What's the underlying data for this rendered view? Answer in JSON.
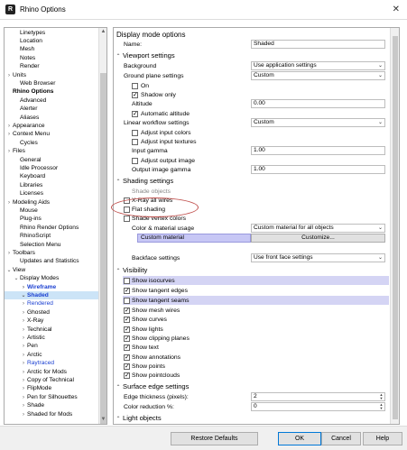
{
  "window": {
    "title": "Rhino Options",
    "close_glyph": "✕"
  },
  "tree": {
    "items": [
      {
        "label": "Linetypes",
        "indent": 1,
        "caret": ""
      },
      {
        "label": "Location",
        "indent": 1,
        "caret": ""
      },
      {
        "label": "Mesh",
        "indent": 1,
        "caret": ""
      },
      {
        "label": "Notes",
        "indent": 1,
        "caret": ""
      },
      {
        "label": "Render",
        "indent": 1,
        "caret": ""
      },
      {
        "label": "Units",
        "indent": 0,
        "caret": ">"
      },
      {
        "label": "Web Browser",
        "indent": 1,
        "caret": ""
      },
      {
        "label": "Rhino Options",
        "indent": 0,
        "caret": "",
        "bold": true
      },
      {
        "label": "Advanced",
        "indent": 1,
        "caret": ""
      },
      {
        "label": "Alerter",
        "indent": 1,
        "caret": ""
      },
      {
        "label": "Aliases",
        "indent": 1,
        "caret": ""
      },
      {
        "label": "Appearance",
        "indent": 0,
        "caret": ">"
      },
      {
        "label": "Context Menu",
        "indent": 0,
        "caret": ">"
      },
      {
        "label": "Cycles",
        "indent": 1,
        "caret": ""
      },
      {
        "label": "Files",
        "indent": 0,
        "caret": ">"
      },
      {
        "label": "General",
        "indent": 1,
        "caret": ""
      },
      {
        "label": "Idle Processor",
        "indent": 1,
        "caret": ""
      },
      {
        "label": "Keyboard",
        "indent": 1,
        "caret": ""
      },
      {
        "label": "Libraries",
        "indent": 1,
        "caret": ""
      },
      {
        "label": "Licenses",
        "indent": 1,
        "caret": ""
      },
      {
        "label": "Modeling Aids",
        "indent": 0,
        "caret": ">"
      },
      {
        "label": "Mouse",
        "indent": 1,
        "caret": ""
      },
      {
        "label": "Plug-ins",
        "indent": 1,
        "caret": ""
      },
      {
        "label": "Rhino Render Options",
        "indent": 1,
        "caret": ""
      },
      {
        "label": "RhinoScript",
        "indent": 1,
        "caret": ""
      },
      {
        "label": "Selection Menu",
        "indent": 1,
        "caret": ""
      },
      {
        "label": "Toolbars",
        "indent": 0,
        "caret": ">"
      },
      {
        "label": "Updates and Statistics",
        "indent": 1,
        "caret": ""
      },
      {
        "label": "View",
        "indent": 0,
        "caret": "v"
      },
      {
        "label": "Display Modes",
        "indent": 1,
        "caret": "v"
      },
      {
        "label": "Wireframe",
        "indent": 2,
        "caret": ">",
        "bold": true,
        "blue": true
      },
      {
        "label": "Shaded",
        "indent": 2,
        "caret": "v",
        "bold": true,
        "blue": true,
        "selected": true
      },
      {
        "label": "Rendered",
        "indent": 2,
        "caret": ">",
        "blue": true
      },
      {
        "label": "Ghosted",
        "indent": 2,
        "caret": ">"
      },
      {
        "label": "X-Ray",
        "indent": 2,
        "caret": ">"
      },
      {
        "label": "Technical",
        "indent": 2,
        "caret": ">"
      },
      {
        "label": "Artistic",
        "indent": 2,
        "caret": ">"
      },
      {
        "label": "Pen",
        "indent": 2,
        "caret": ">"
      },
      {
        "label": "Arctic",
        "indent": 2,
        "caret": ">"
      },
      {
        "label": "Raytraced",
        "indent": 2,
        "caret": ">",
        "blue": true
      },
      {
        "label": "Arctic for Mods",
        "indent": 2,
        "caret": ">"
      },
      {
        "label": "Copy of Technical",
        "indent": 2,
        "caret": ">"
      },
      {
        "label": "FlipMode",
        "indent": 2,
        "caret": ">"
      },
      {
        "label": "Pen for Silhouettes",
        "indent": 2,
        "caret": ">"
      },
      {
        "label": "Shade",
        "indent": 2,
        "caret": ">"
      },
      {
        "label": "Shaded for Mods",
        "indent": 2,
        "caret": ">"
      }
    ]
  },
  "panel": {
    "display_mode_options": "Display mode options",
    "name_label": "Name:",
    "name_value": "Shaded",
    "viewport_settings": "Viewport settings",
    "background_label": "Background",
    "background_value": "Use application settings",
    "ground_plane_label": "Ground plane settings",
    "ground_plane_value": "Custom",
    "on_label": "On",
    "shadow_only_label": "Shadow only",
    "altitude_label": "Altitude",
    "altitude_value": "0.00",
    "automatic_altitude_label": "Automatic altitude",
    "linear_workflow_label": "Linear workflow settings",
    "linear_workflow_value": "Custom",
    "adjust_input_colors": "Adjust input colors",
    "adjust_input_textures": "Adjust input textures",
    "input_gamma_label": "Input gamma",
    "input_gamma_value": "1.00",
    "adjust_output_image": "Adjust output image",
    "output_gamma_label": "Output image gamma",
    "output_gamma_value": "1.00",
    "shading_settings": "Shading settings",
    "shade_objects": "Shade objects",
    "xray_all_wires": "X-Ray all wires",
    "flat_shading": "Flat shading",
    "shade_vertex_colors": "Shade vertex colors",
    "color_material_label": "Color & material usage",
    "color_material_value": "Custom material for all objects",
    "custom_material": "Custom material",
    "customize_button": "Customize...",
    "backface_label": "Backface settings",
    "backface_value": "Use front face settings",
    "visibility": "Visibility",
    "show_isocurves": "Show isocurves",
    "show_tangent_edges": "Show tangent edges",
    "show_tangent_seams": "Show tangent seams",
    "show_mesh_wires": "Show mesh wires",
    "show_curves": "Show curves",
    "show_lights": "Show lights",
    "show_clipping_planes": "Show clipping planes",
    "show_text": "Show text",
    "show_annotations": "Show annotations",
    "show_points": "Show points",
    "show_pointclouds": "Show pointclouds",
    "surface_edge_settings": "Surface edge settings",
    "edge_thickness_label": "Edge thickness (pixels):",
    "edge_thickness_value": "2",
    "color_reduction_label": "Color reduction %:",
    "color_reduction_value": "0",
    "light_objects": "Light objects"
  },
  "buttons": {
    "restore_defaults": "Restore Defaults",
    "ok": "OK",
    "cancel": "Cancel",
    "help": "Help"
  },
  "colors": {
    "selection": "#cce4f7",
    "link_blue": "#1a3fd1",
    "highlight_row": "#d4d4f4",
    "annotation_ellipse": "#c0504d"
  }
}
